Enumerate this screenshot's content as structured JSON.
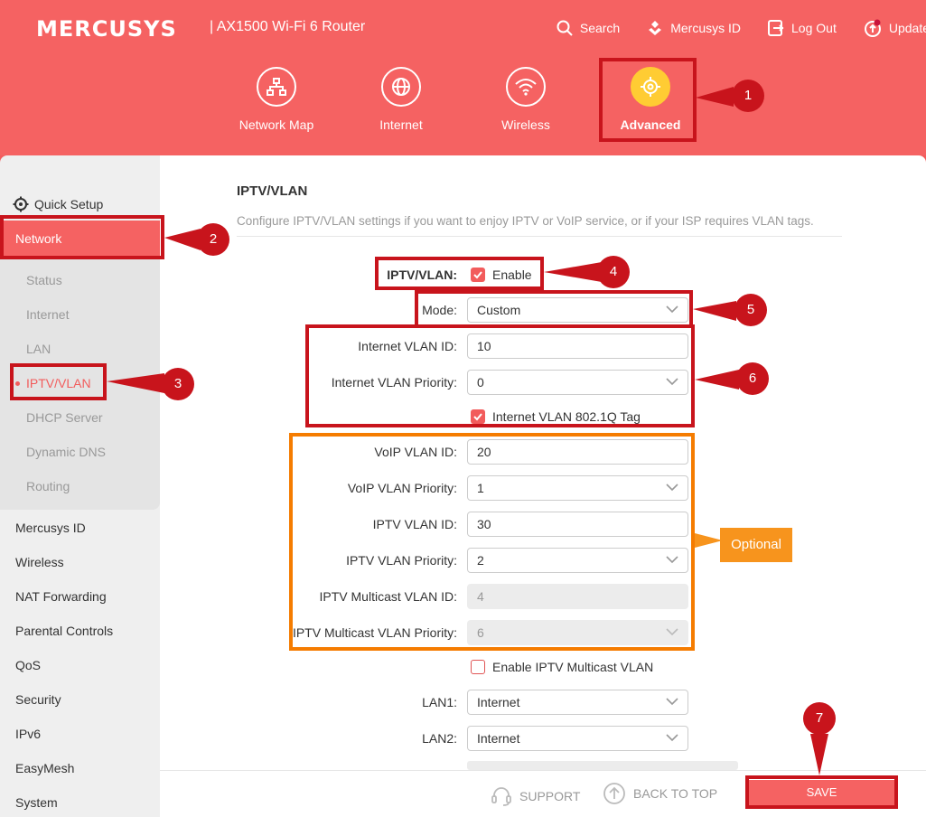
{
  "header": {
    "brand": "MERCUSYS",
    "model": "| AX1500 Wi-Fi 6 Router",
    "links": {
      "search": "Search",
      "mercusys_id": "Mercusys ID",
      "logout": "Log Out",
      "update": "Update"
    },
    "tabs": {
      "network_map": "Network Map",
      "internet": "Internet",
      "wireless": "Wireless",
      "advanced": "Advanced"
    },
    "accent": "#ffcc33"
  },
  "sidebar": {
    "quick_setup": "Quick Setup",
    "network": "Network",
    "network_sub": {
      "status": "Status",
      "internet": "Internet",
      "lan": "LAN",
      "iptv": "IPTV/VLAN",
      "dhcp": "DHCP Server",
      "ddns": "Dynamic DNS",
      "routing": "Routing"
    },
    "items": {
      "mercusys_id": "Mercusys ID",
      "wireless": "Wireless",
      "nat": "NAT Forwarding",
      "parental": "Parental Controls",
      "qos": "QoS",
      "security": "Security",
      "ipv6": "IPv6",
      "easymesh": "EasyMesh",
      "system": "System"
    }
  },
  "main": {
    "title": "IPTV/VLAN",
    "description": "Configure IPTV/VLAN settings if you want to enjoy IPTV or VoIP service, or if your ISP requires VLAN tags.",
    "iptv_label": "IPTV/VLAN:",
    "enable_label": "Enable",
    "mode_label": "Mode:",
    "mode_value": "Custom",
    "internet_vlan_id_label": "Internet VLAN ID:",
    "internet_vlan_id": "10",
    "internet_vlan_priority_label": "Internet VLAN Priority:",
    "internet_vlan_priority": "0",
    "tag_label": "Internet VLAN 802.1Q Tag",
    "voip_vlan_id_label": "VoIP VLAN ID:",
    "voip_vlan_id": "20",
    "voip_vlan_priority_label": "VoIP VLAN Priority:",
    "voip_vlan_priority": "1",
    "iptv_vlan_id_label": "IPTV VLAN ID:",
    "iptv_vlan_id": "30",
    "iptv_vlan_priority_label": "IPTV VLAN Priority:",
    "iptv_vlan_priority": "2",
    "iptv_mc_vlan_id_label": "IPTV Multicast VLAN ID:",
    "iptv_mc_vlan_id": "4",
    "iptv_mc_vlan_priority_label": "IPTV Multicast VLAN Priority:",
    "iptv_mc_vlan_priority": "6",
    "enable_mc_label": "Enable IPTV Multicast VLAN",
    "lan1_label": "LAN1:",
    "lan1_value": "Internet",
    "lan2_label": "LAN2:",
    "lan2_value": "Internet"
  },
  "footer": {
    "support": "SUPPORT",
    "back_to_top": "BACK TO TOP",
    "save": "SAVE"
  },
  "annotations": {
    "n1": "1",
    "n2": "2",
    "n3": "3",
    "n4": "4",
    "n5": "5",
    "n6": "6",
    "n7": "7",
    "optional": "Optional"
  }
}
